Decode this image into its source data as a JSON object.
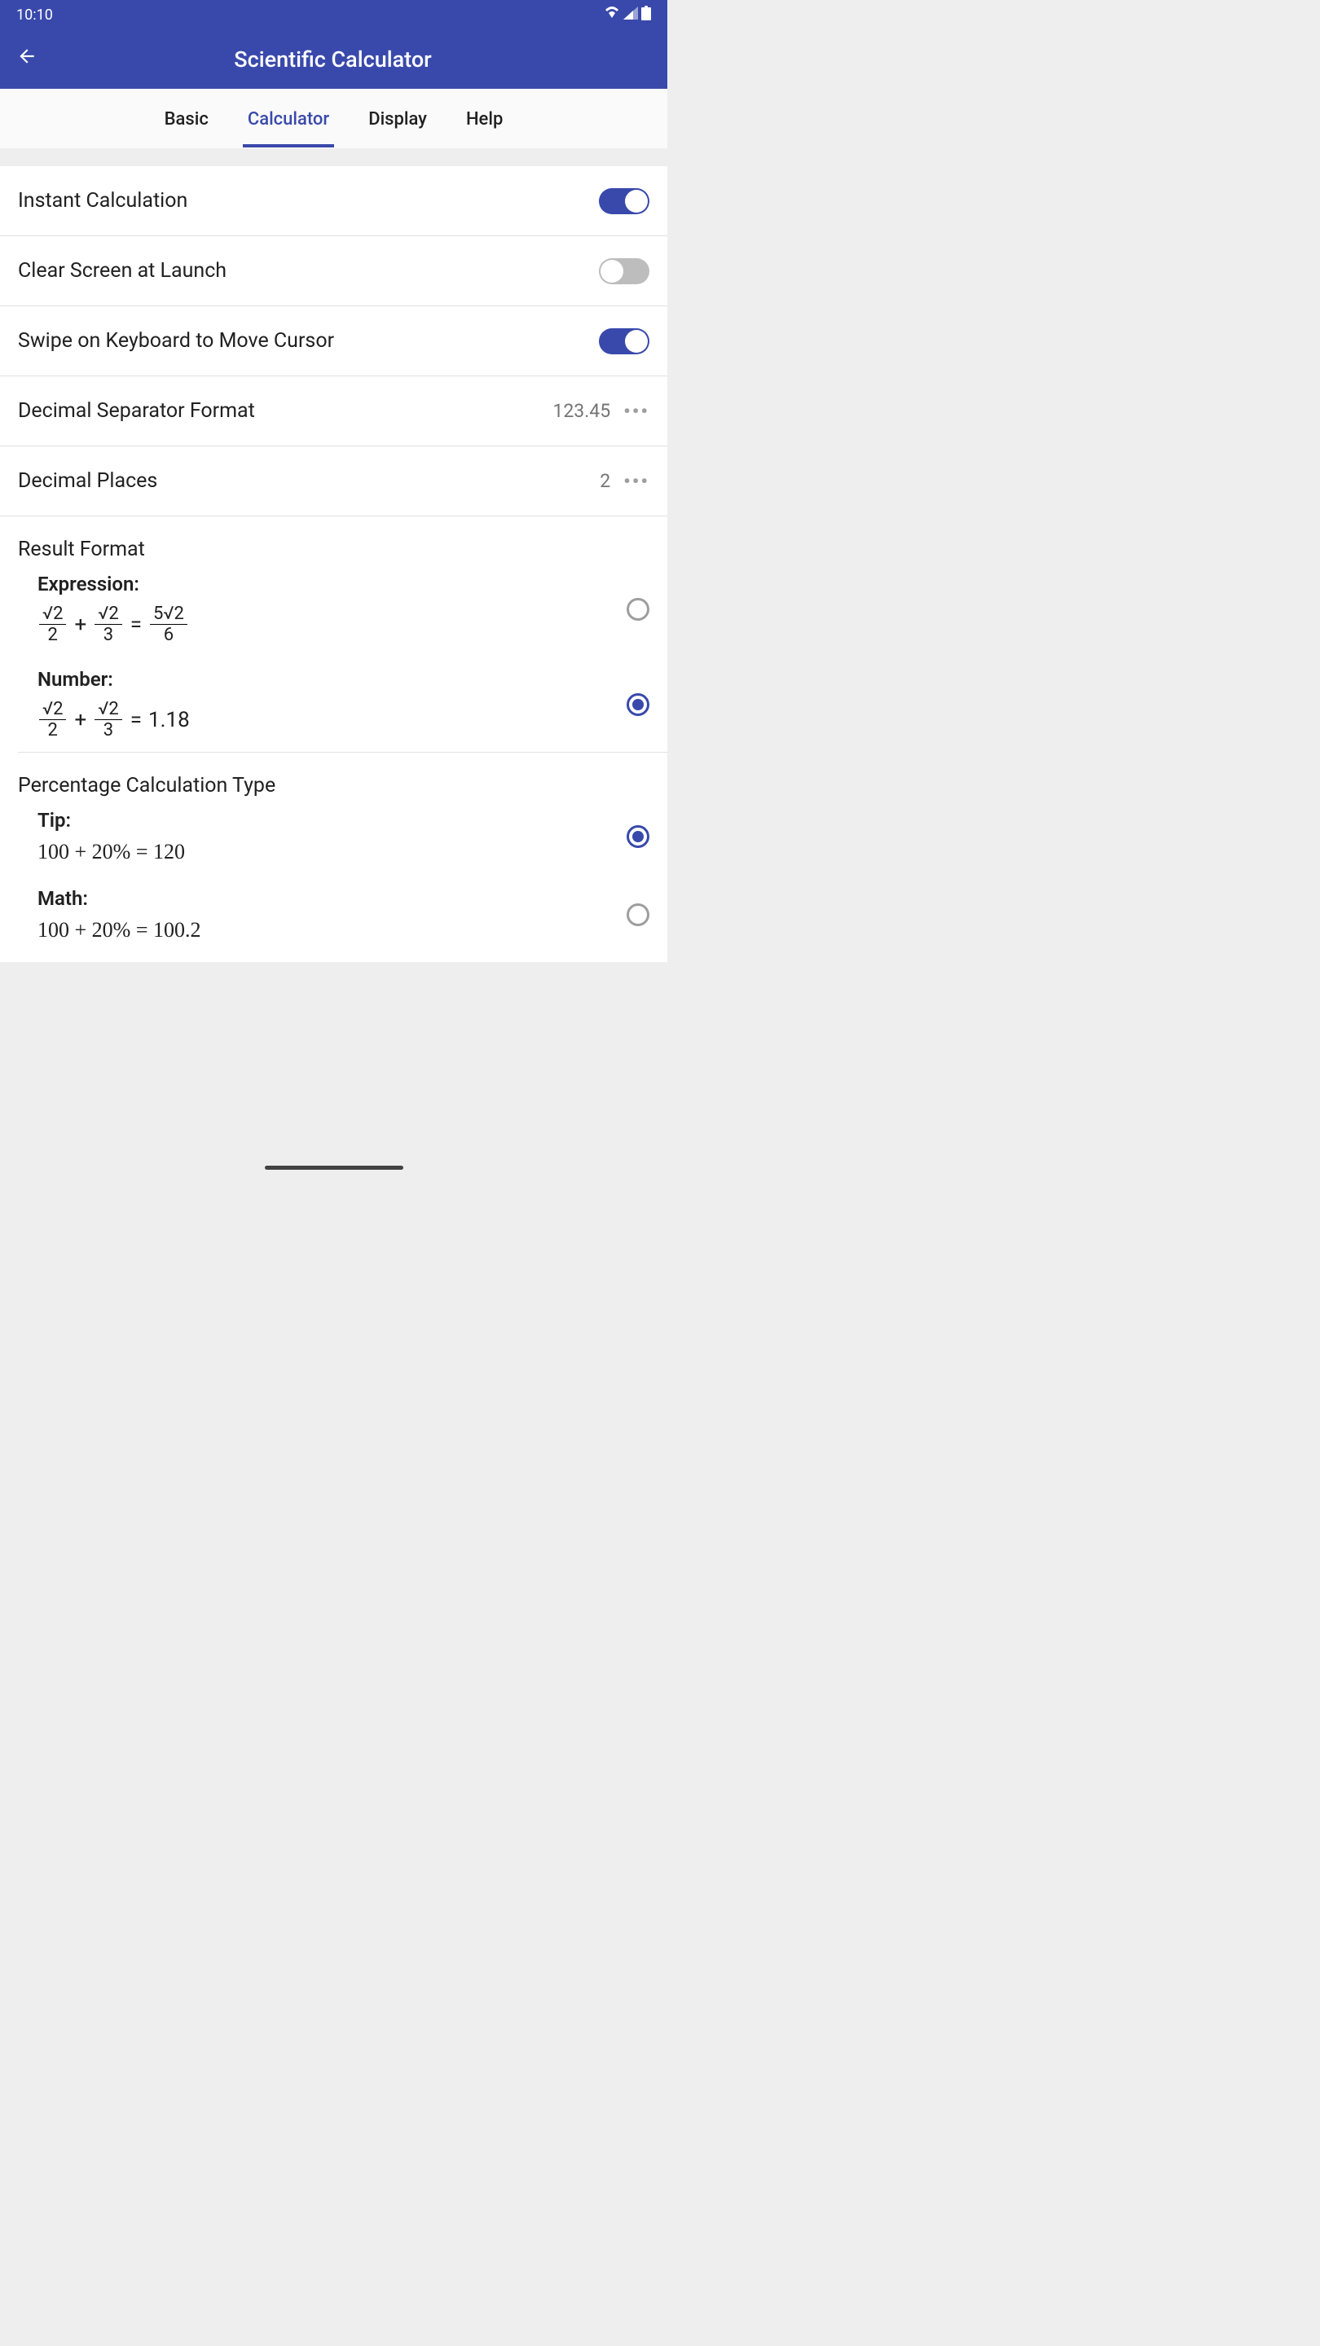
{
  "status": {
    "time": "10:10"
  },
  "header": {
    "title": "Scientific Calculator"
  },
  "tabs": {
    "basic": "Basic",
    "calculator": "Calculator",
    "display": "Display",
    "help": "Help"
  },
  "settings": {
    "instant_calc": {
      "label": "Instant Calculation",
      "enabled": true
    },
    "clear_screen": {
      "label": "Clear Screen at Launch",
      "enabled": false
    },
    "swipe_cursor": {
      "label": "Swipe on Keyboard to Move Cursor",
      "enabled": true
    },
    "decimal_separator": {
      "label": "Decimal Separator Format",
      "value": "123.45"
    },
    "decimal_places": {
      "label": "Decimal Places",
      "value": "2"
    },
    "result_format": {
      "title": "Result Format",
      "expression_label": "Expression:",
      "number_label": "Number:",
      "number_result": "1.18",
      "selected": "number"
    },
    "percentage_type": {
      "title": "Percentage Calculation Type",
      "tip_label": "Tip:",
      "tip_formula": "100 + 20% = 120",
      "math_label": "Math:",
      "math_formula": "100 + 20% = 100.2",
      "selected": "tip"
    }
  }
}
